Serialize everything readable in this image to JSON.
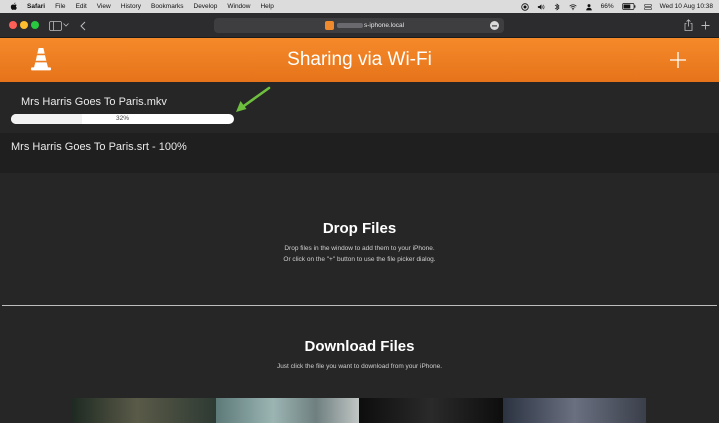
{
  "menubar": {
    "items": [
      "Safari",
      "File",
      "Edit",
      "View",
      "History",
      "Bookmarks",
      "Develop",
      "Window",
      "Help"
    ],
    "battery": "66%",
    "clock": "Wed 10 Aug  10:38"
  },
  "browser": {
    "address": "s-iphone.local"
  },
  "header": {
    "title": "Sharing via Wi-Fi"
  },
  "uploads": [
    {
      "name": "Mrs Harris Goes To Paris.mkv",
      "progress_label": "32%",
      "progress": 0.32
    },
    {
      "name": "Mrs Harris Goes To Paris.srt - 100%"
    }
  ],
  "drop": {
    "title": "Drop Files",
    "line1": "Drop files in the window to add them to your iPhone.",
    "line2": "Or click on the \"+\" button to use the file picker dialog."
  },
  "download": {
    "title": "Download Files",
    "subtitle": "Just click the file you want to download from your iPhone."
  },
  "colors": {
    "vlc_orange": "#f0801f",
    "background": "#262626",
    "arrow_green": "#6fbf3f"
  }
}
